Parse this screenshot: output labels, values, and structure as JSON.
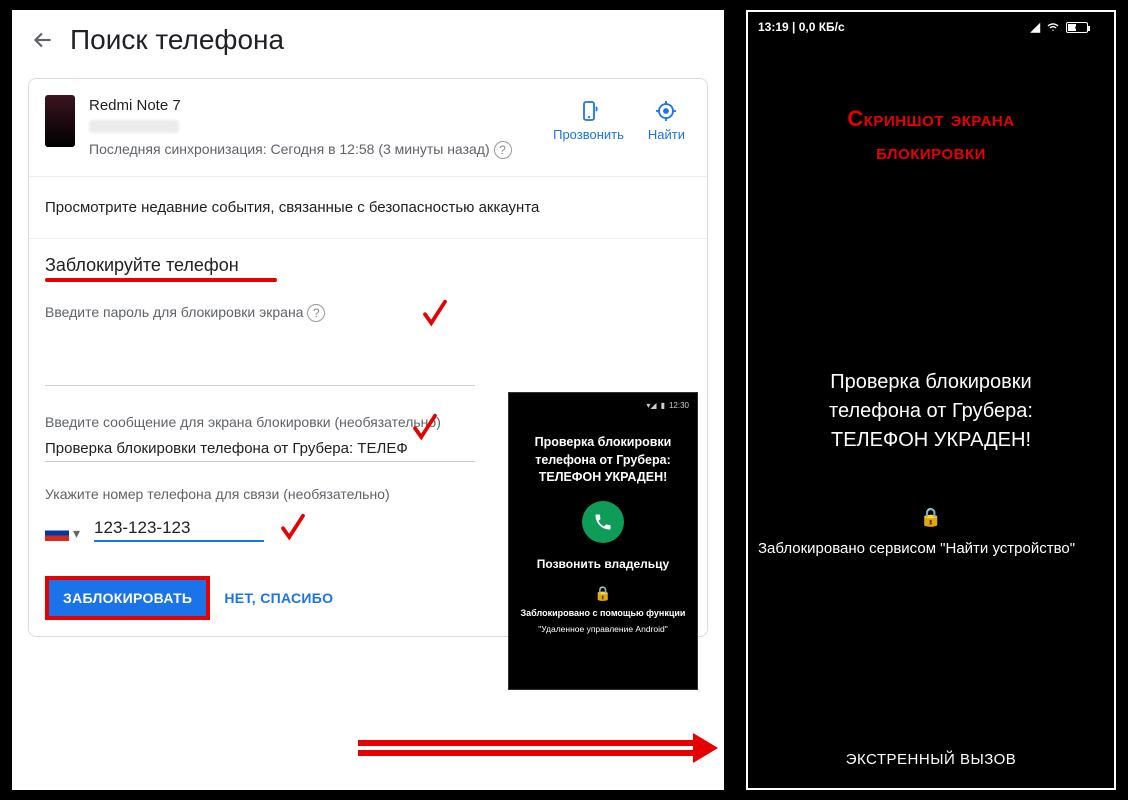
{
  "left": {
    "title": "Поиск телефона",
    "device": {
      "name": "Redmi Note 7",
      "sync": "Последняя синхронизация: Сегодня в 12:58 (3 минуты назад)"
    },
    "actions": {
      "ring": "Прозвонить",
      "find": "Найти"
    },
    "security_review": "Просмотрите недавние события, связанные с безопасностью аккаунта",
    "lock": {
      "heading": "Заблокируйте телефон",
      "password_label": "Введите пароль для блокировки экрана",
      "message_label": "Введите сообщение для экрана блокировки (необязательно)",
      "message_value": "Проверка блокировки телефона от Грубера: ТЕЛЕФ",
      "phone_label": "Укажите номер телефона для связи (необязательно)",
      "phone_value": "123-123-123",
      "btn_lock": "ЗАБЛОКИРОВАТЬ",
      "btn_no": "НЕТ, СПАСИБО"
    },
    "preview": {
      "status_time": "12:30",
      "msg_line1": "Проверка блокировки",
      "msg_line2": "телефона от Грубера:",
      "msg_line3": "ТЕЛЕФОН УКРАДЕН!",
      "call_owner": "Позвонить владельцу",
      "lock_note": "Заблокировано с помощью функции",
      "lock_note2": "\"Удаленное управление Android\""
    }
  },
  "right": {
    "status_time": "13:19 | 0,0 КБ/с",
    "battery": "43",
    "title_line1": "Скриншот экрана",
    "title_line2": "блокировки",
    "msg_line1": "Проверка блокировки",
    "msg_line2": "телефона от Грубера:",
    "msg_line3": "ТЕЛЕФОН УКРАДЕН!",
    "locked_by": "Заблокировано сервисом \"Найти устройство\"",
    "emergency": "ЭКСТРЕННЫЙ ВЫЗОВ"
  }
}
